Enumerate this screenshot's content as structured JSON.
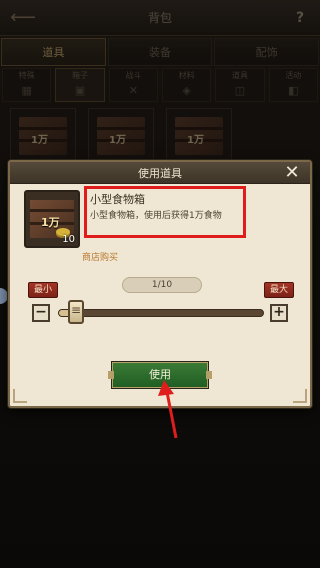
{
  "header": {
    "title": "背包",
    "help_label": "?",
    "back_icon": "back-arrow-icon"
  },
  "tabs": [
    {
      "label": "道具",
      "active": true
    },
    {
      "label": "装备",
      "active": false
    },
    {
      "label": "配饰",
      "active": false
    }
  ],
  "filters": [
    {
      "label": "特殊",
      "icon": "grid-icon"
    },
    {
      "label": "箱子",
      "icon": "box-icon",
      "active": true
    },
    {
      "label": "战斗",
      "icon": "swords-icon"
    },
    {
      "label": "材料",
      "icon": "fish-icon"
    },
    {
      "label": "道具",
      "icon": "chest-icon"
    },
    {
      "label": "活动",
      "icon": "bag-icon"
    }
  ],
  "inventory": [
    {
      "tag": "1万"
    },
    {
      "tag": "1万"
    },
    {
      "tag": "1万"
    }
  ],
  "dialog": {
    "title": "使用道具",
    "item": {
      "name": "小型食物箱",
      "description": "小型食物箱，使用后获得1万食物",
      "badge": "1万",
      "count": "10"
    },
    "shop_link": "商店购买",
    "min_label": "最小",
    "max_label": "最大",
    "quantity_text": "1/10",
    "slider": {
      "value": 1,
      "max": 10
    },
    "use_label": "使用"
  },
  "colors": {
    "highlight": "#e01d1d",
    "use_button": "#2f6e2c",
    "min_max": "#8f2a1e"
  }
}
